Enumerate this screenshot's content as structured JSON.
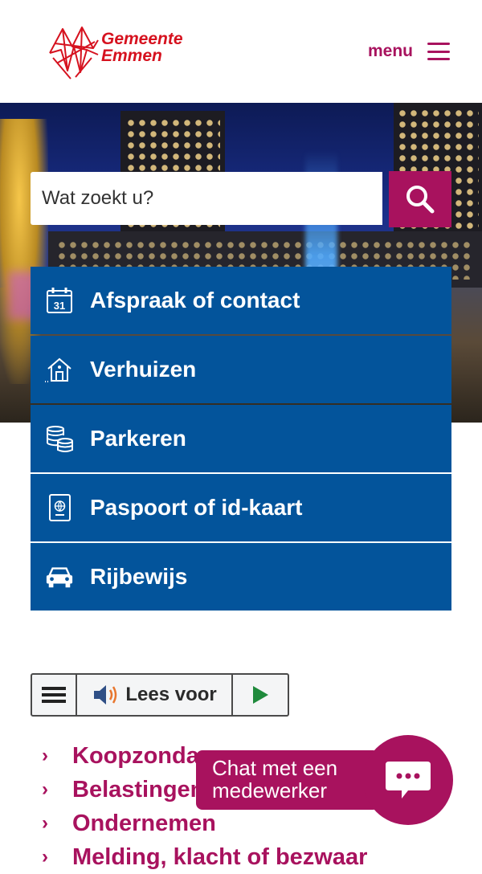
{
  "header": {
    "logo_line1": "Gemeente",
    "logo_line2": "Emmen",
    "menu_label": "menu",
    "brand_color": "#a8125e"
  },
  "search": {
    "placeholder": "Wat zoekt u?",
    "button_icon": "search-icon"
  },
  "quick_links": [
    {
      "label": "Afspraak of contact",
      "icon": "calendar-icon",
      "icon_text": "31"
    },
    {
      "label": "Verhuizen",
      "icon": "house-icon"
    },
    {
      "label": "Parkeren",
      "icon": "coins-icon"
    },
    {
      "label": "Paspoort of id-kaart",
      "icon": "passport-icon"
    },
    {
      "label": "Rijbewijs",
      "icon": "car-icon"
    }
  ],
  "quick_link_color": "#03549b",
  "reader": {
    "label": "Lees voor",
    "menu_icon": "hamburger-icon",
    "speaker_icon": "speaker-icon",
    "play_icon": "play-icon"
  },
  "links": [
    {
      "label": "Koopzondagen"
    },
    {
      "label": "Belastingen"
    },
    {
      "label": "Ondernemen"
    },
    {
      "label": "Melding, klacht of bezwaar"
    }
  ],
  "chat": {
    "label": "Chat met een medewerker",
    "icon": "chat-icon"
  }
}
